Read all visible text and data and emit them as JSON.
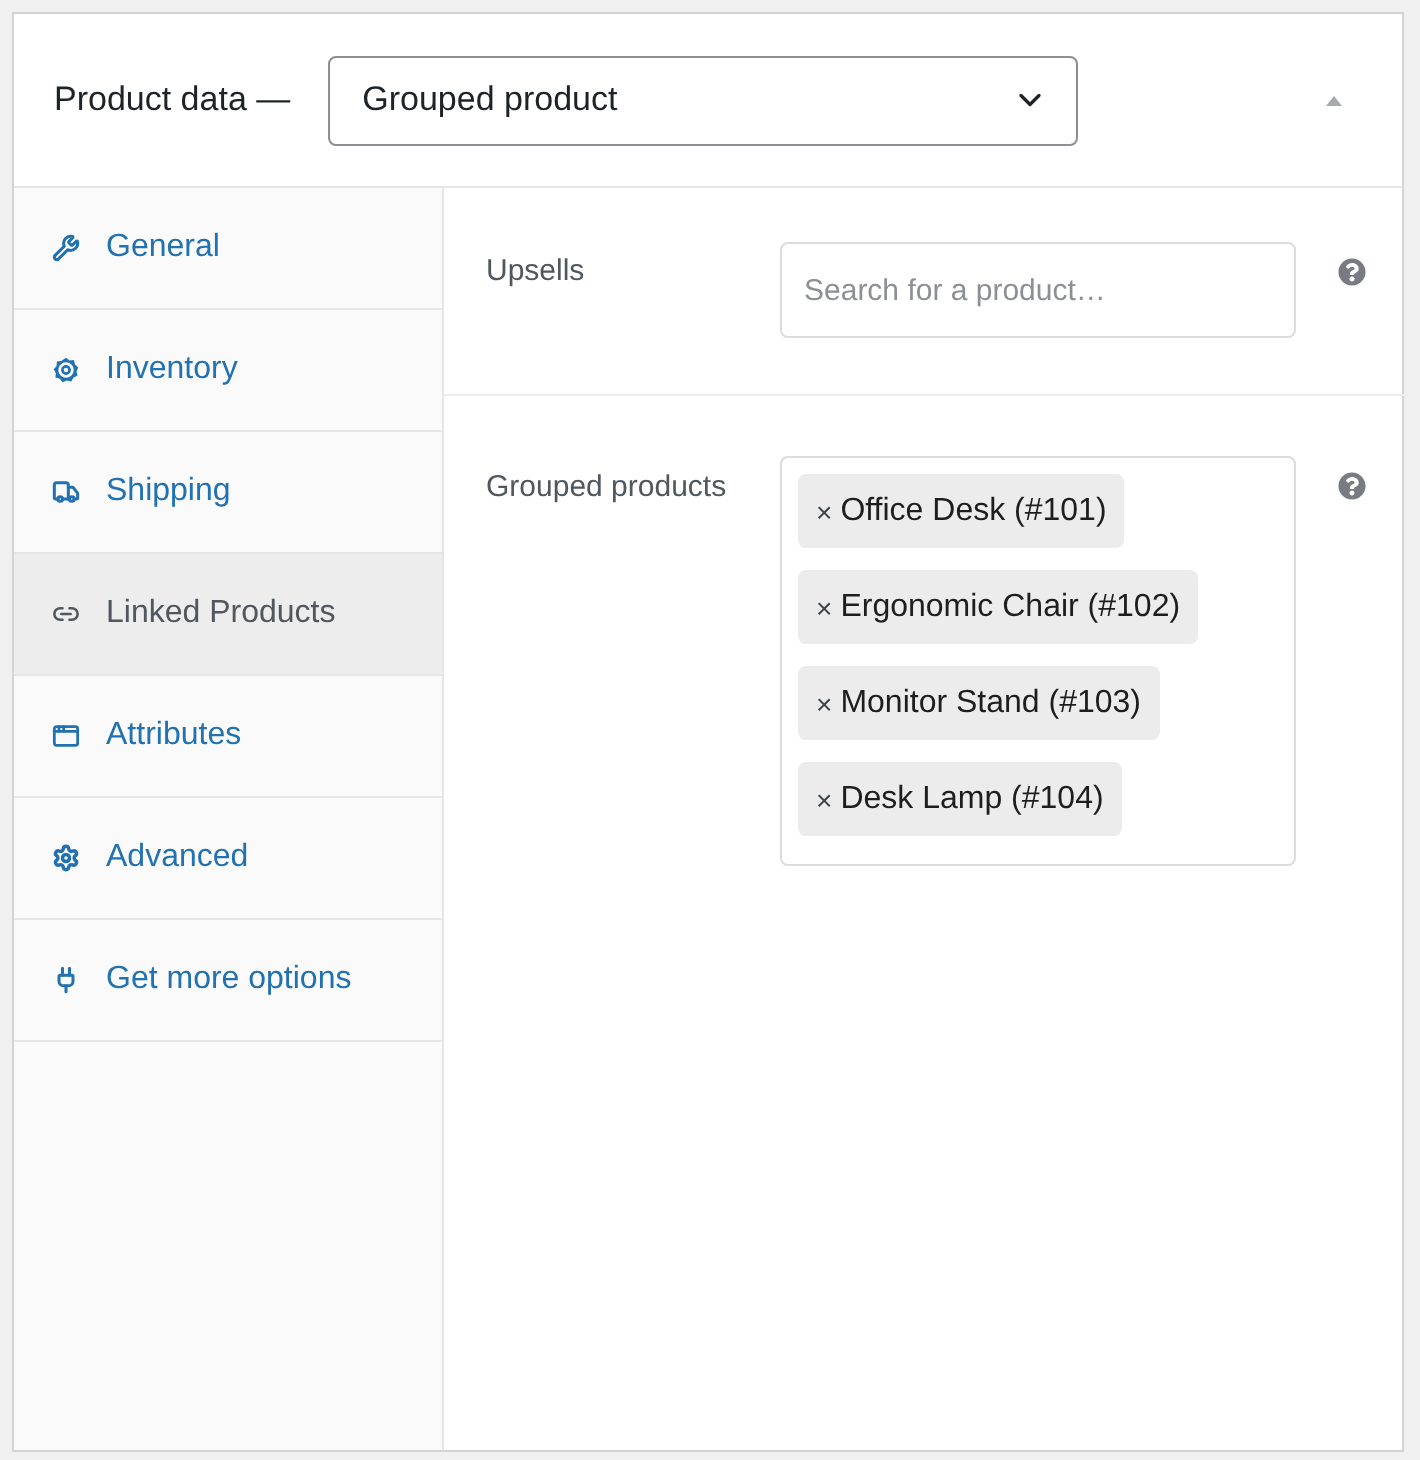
{
  "header": {
    "title": "Product data —",
    "product_type": {
      "value": "Grouped product"
    }
  },
  "tabs": [
    {
      "label": "General",
      "selected": false
    },
    {
      "label": "Inventory",
      "selected": false
    },
    {
      "label": "Shipping",
      "selected": false
    },
    {
      "label": "Linked Products",
      "selected": true
    },
    {
      "label": "Attributes",
      "selected": false
    },
    {
      "label": "Advanced",
      "selected": false
    },
    {
      "label": "Get more options",
      "selected": false
    }
  ],
  "fields": [
    {
      "kind": "search",
      "label": "Upsells",
      "placeholder": "Search for a product…"
    },
    {
      "kind": "tokens",
      "label": "Grouped products",
      "tokens": [
        {
          "remove": "×",
          "label": "Office Desk (#101)"
        },
        {
          "remove": "×",
          "label": "Ergonomic Chair (#102)"
        },
        {
          "remove": "×",
          "label": "Monitor Stand (#103)"
        },
        {
          "remove": "×",
          "label": "Desk Lamp (#104)"
        }
      ]
    }
  ]
}
